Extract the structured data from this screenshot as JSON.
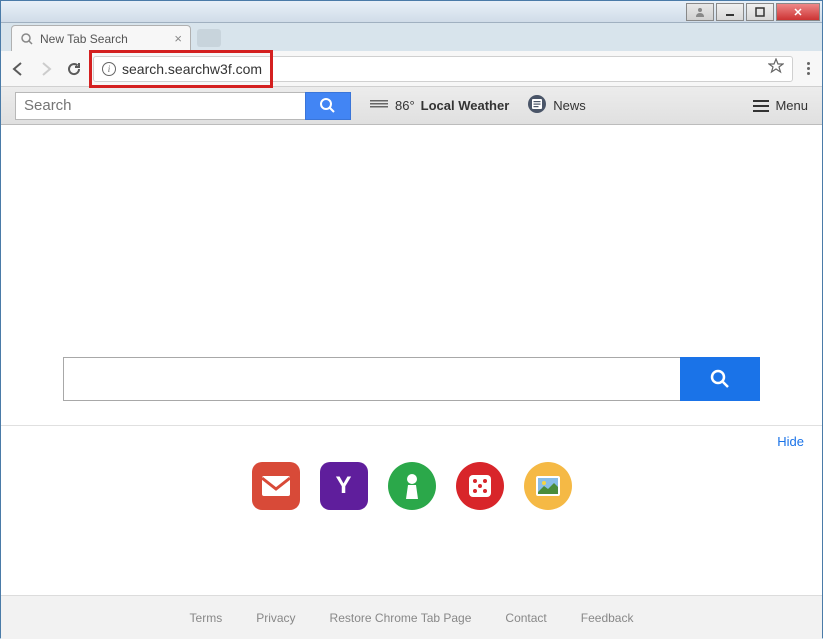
{
  "window": {
    "title": "New Tab Search"
  },
  "tab": {
    "title": "New Tab Search"
  },
  "address": {
    "url": "search.searchw3f.com"
  },
  "toolbar": {
    "search_placeholder": "Search",
    "weather_temp": "86°",
    "weather_label": "Local Weather",
    "news_label": "News",
    "menu_label": "Menu"
  },
  "main": {
    "search_value": ""
  },
  "tiles": {
    "hide_label": "Hide",
    "items": [
      "gmail",
      "yahoo",
      "games",
      "dice",
      "photo"
    ]
  },
  "footer": {
    "links": [
      "Terms",
      "Privacy",
      "Restore Chrome Tab Page",
      "Contact",
      "Feedback"
    ]
  }
}
